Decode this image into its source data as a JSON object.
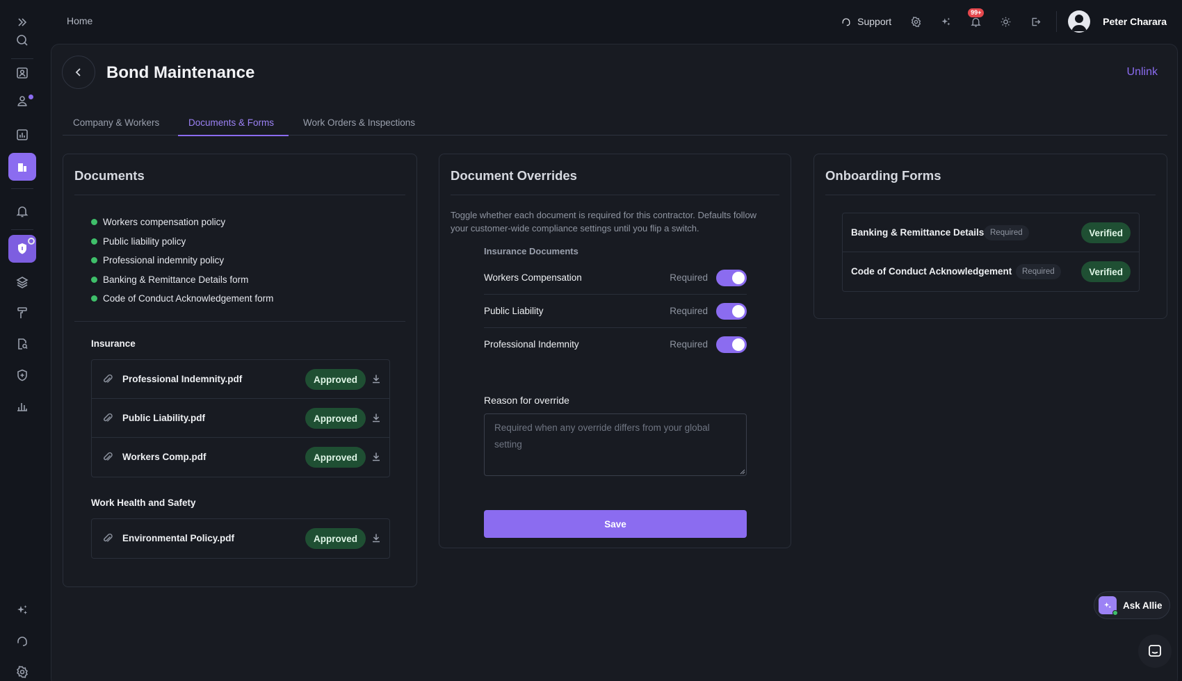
{
  "topbar": {
    "breadcrumb": "Home",
    "support_label": "Support",
    "notification_badge": "99+",
    "user_name": "Peter Charara"
  },
  "page": {
    "title": "Bond Maintenance",
    "unlink_label": "Unlink"
  },
  "tabs": [
    {
      "label": "Company & Workers",
      "active": false
    },
    {
      "label": "Documents & Forms",
      "active": true
    },
    {
      "label": "Work Orders & Inspections",
      "active": false
    }
  ],
  "documents": {
    "title": "Documents",
    "requirements": [
      "Workers compensation policy",
      "Public liability policy",
      "Professional indemnity policy",
      "Banking & Remittance Details form",
      "Code of Conduct Acknowledgement form"
    ],
    "insurance_label": "Insurance",
    "insurance_files": [
      {
        "name": "Professional Indemnity.pdf",
        "status": "Approved"
      },
      {
        "name": "Public Liability.pdf",
        "status": "Approved"
      },
      {
        "name": "Workers Comp.pdf",
        "status": "Approved"
      }
    ],
    "whs_label": "Work Health and Safety",
    "whs_files": [
      {
        "name": "Environmental Policy.pdf",
        "status": "Approved"
      }
    ]
  },
  "overrides": {
    "title": "Document Overrides",
    "hint": "Toggle whether each document is required for this contractor. Defaults follow your customer-wide compliance settings until you flip a switch.",
    "section_label": "Insurance Documents",
    "items": [
      {
        "label": "Workers Compensation",
        "state": "Required",
        "on": true
      },
      {
        "label": "Public Liability",
        "state": "Required",
        "on": true
      },
      {
        "label": "Professional Indemnity",
        "state": "Required",
        "on": true
      }
    ],
    "reason_label": "Reason for override",
    "reason_value": "",
    "reason_placeholder": "Required when any override differs from your global setting",
    "save_label": "Save"
  },
  "onboarding": {
    "title": "Onboarding Forms",
    "forms": [
      {
        "name": "Banking & Remittance Details",
        "tag": "Required",
        "status": "Verified"
      },
      {
        "name": "Code of Conduct Acknowledgement",
        "tag": "Required",
        "status": "Verified"
      }
    ]
  },
  "assistant": {
    "label": "Ask Allie"
  },
  "colors": {
    "accent": "#8b6cf0",
    "background": "#13161d",
    "panel": "#181b22",
    "success_bg": "#1f4f33",
    "status_dot": "#3fbf6a"
  }
}
